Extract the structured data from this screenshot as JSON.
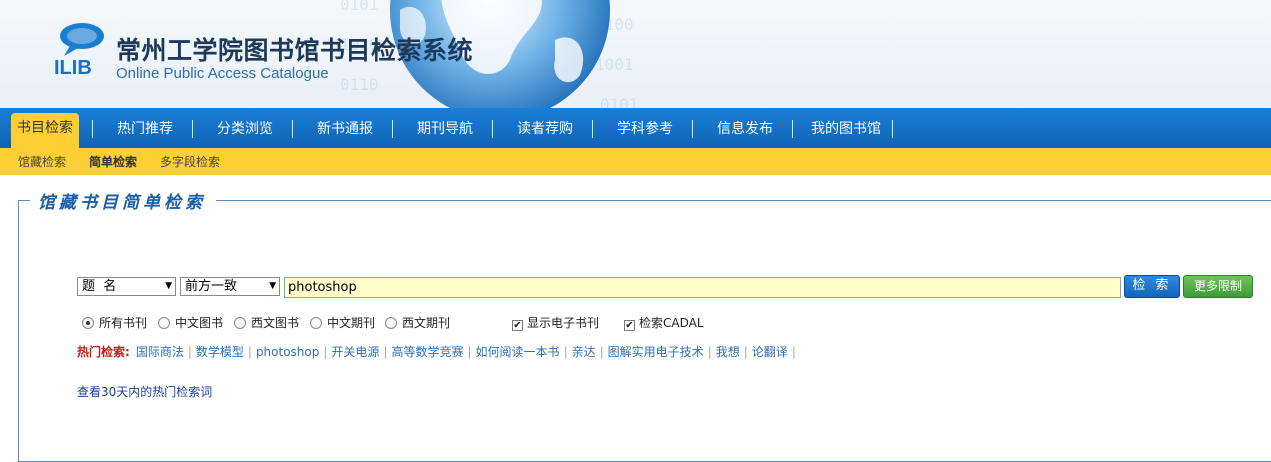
{
  "header": {
    "logo_text": "ILIB",
    "title": "常州工学院图书馆书目检索系统",
    "subtitle": "Online Public Access Catalogue"
  },
  "main_nav": [
    {
      "label": "书目检索",
      "active": true
    },
    {
      "label": "热门推荐",
      "active": false
    },
    {
      "label": "分类浏览",
      "active": false
    },
    {
      "label": "新书通报",
      "active": false
    },
    {
      "label": "期刊导航",
      "active": false
    },
    {
      "label": "读者荐购",
      "active": false
    },
    {
      "label": "学科参考",
      "active": false
    },
    {
      "label": "信息发布",
      "active": false
    },
    {
      "label": "我的图书馆",
      "active": false
    }
  ],
  "sub_nav": [
    {
      "label": "馆藏检索",
      "active": false
    },
    {
      "label": "简单检索",
      "active": true
    },
    {
      "label": "多字段检索",
      "active": false
    }
  ],
  "panel": {
    "legend": "馆藏书目简单检索"
  },
  "search": {
    "field_select": "题  名",
    "match_select": "前方一致",
    "query": "photoshop",
    "search_label": "检 索",
    "more_label": "更多限制"
  },
  "doc_types": [
    {
      "label": "所有书刊",
      "checked": true
    },
    {
      "label": "中文图书",
      "checked": false
    },
    {
      "label": "西文图书",
      "checked": false
    },
    {
      "label": "中文期刊",
      "checked": false
    },
    {
      "label": "西文期刊",
      "checked": false
    }
  ],
  "options": [
    {
      "label": "显示电子书刊",
      "checked": true
    },
    {
      "label": "检索CADAL",
      "checked": true
    }
  ],
  "hot": {
    "label": "热门检索:",
    "keywords": [
      "国际商法",
      "数学模型",
      "photoshop",
      "开关电源",
      "高等数学竞赛",
      "如何阅读一本书",
      "亲达",
      "图解实用电子技术",
      "我想",
      "论翻译"
    ]
  },
  "hot30": {
    "label": "查看30天内的热门检索词"
  },
  "colors": {
    "nav_blue": "#1272c8",
    "accent_yellow": "#fccf34",
    "input_bg": "#ffffcc",
    "search_btn": "#1b6fc4",
    "more_btn": "#4da544"
  }
}
